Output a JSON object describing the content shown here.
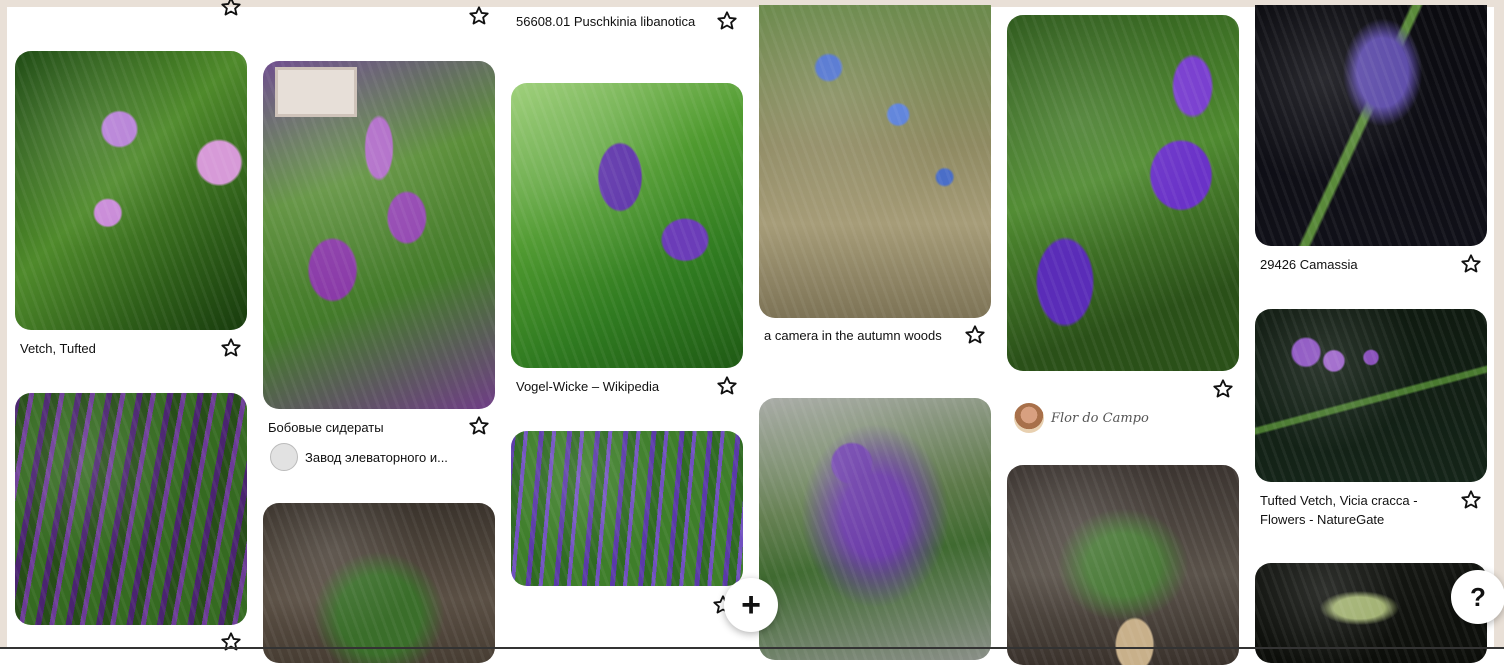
{
  "pins": [
    {
      "id": "p1",
      "title": "Vetch, Tufted"
    },
    {
      "id": "p2",
      "title": "Бобовые сидераты",
      "owner": "Завод элеваторного и..."
    },
    {
      "id": "p3",
      "title": "56608.01 Puschkinia libanotica"
    },
    {
      "id": "p4",
      "title": "Vogel-Wicke – Wikipedia"
    },
    {
      "id": "p5",
      "title": "a camera in the autumn woods"
    },
    {
      "id": "p6",
      "owner": "Flor do Campo"
    },
    {
      "id": "p7",
      "title": "29426 Camassia"
    },
    {
      "id": "p8",
      "title": "Tufted Vetch, Vicia cracca - Flowers - NatureGate"
    }
  ],
  "fab": {
    "add_label": "+",
    "help_label": "?"
  },
  "icons": {
    "save": "star-icon",
    "add": "plus-icon",
    "help": "question-icon"
  }
}
